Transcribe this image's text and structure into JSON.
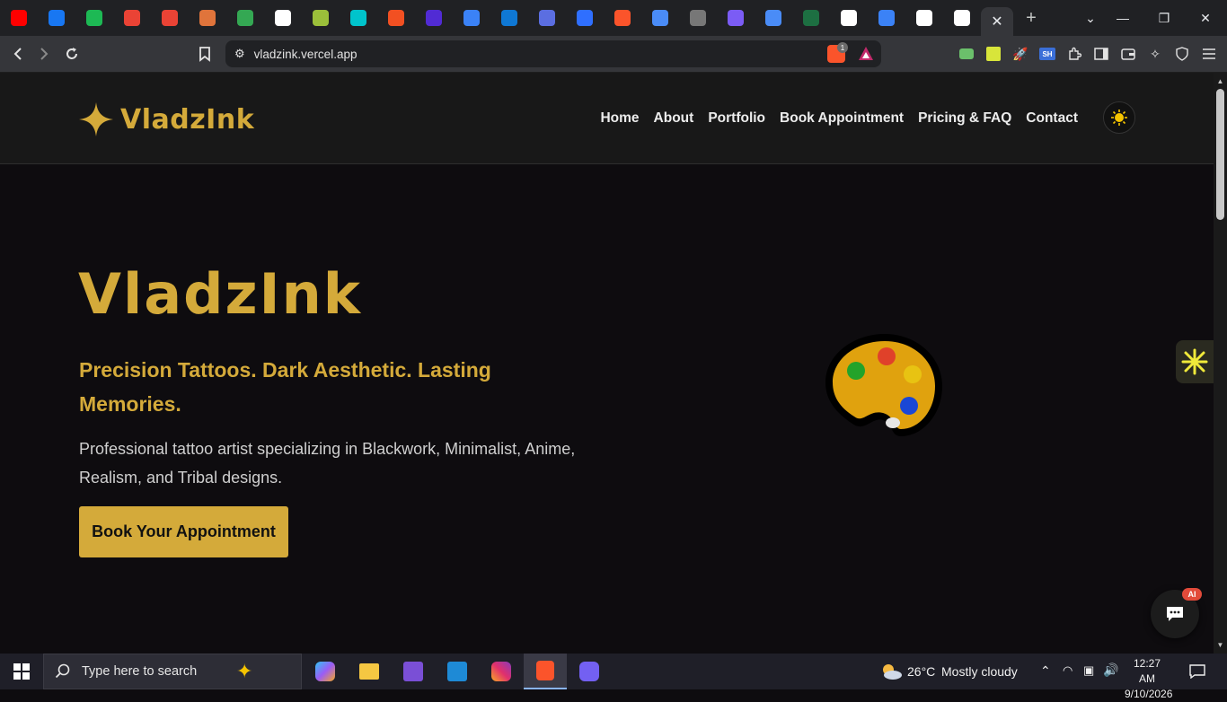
{
  "browser": {
    "tabs": [
      {
        "icon": "youtube-icon",
        "color": "#ff0000"
      },
      {
        "icon": "facebook-icon",
        "color": "#1877f2"
      },
      {
        "icon": "chat-icon",
        "color": "#1db954"
      },
      {
        "icon": "gmail-icon",
        "color": "#ea4335"
      },
      {
        "icon": "gmail-icon",
        "color": "#ea4335"
      },
      {
        "icon": "app-icon",
        "color": "#e0743b"
      },
      {
        "icon": "drive-icon",
        "color": "#34a853"
      },
      {
        "icon": "threads-icon",
        "color": "#ffffff"
      },
      {
        "icon": "app-icon",
        "color": "#9bbf3a"
      },
      {
        "icon": "canva-icon",
        "color": "#00c4cc"
      },
      {
        "icon": "microsoft-icon",
        "color": "#f25022"
      },
      {
        "icon": "dotnet-icon",
        "color": "#512bd4"
      },
      {
        "icon": "app-icon",
        "color": "#3b82f6"
      },
      {
        "icon": "onedrive-icon",
        "color": "#0f78d4"
      },
      {
        "icon": "app-icon",
        "color": "#5b6ee1"
      },
      {
        "icon": "app-icon",
        "color": "#2f6fff"
      },
      {
        "icon": "brave-icon",
        "color": "#fb542b"
      },
      {
        "icon": "gemini-icon",
        "color": "#4a8cf7"
      },
      {
        "icon": "app-icon",
        "color": "#777777"
      },
      {
        "icon": "infinity-icon",
        "color": "#7b5cf5"
      },
      {
        "icon": "gemini-icon",
        "color": "#4a8cf7"
      },
      {
        "icon": "excel-icon",
        "color": "#1d6f42"
      },
      {
        "icon": "openai-icon",
        "color": "#ffffff"
      },
      {
        "icon": "app-icon",
        "color": "#3b82f6"
      },
      {
        "icon": "github-icon",
        "color": "#ffffff"
      },
      {
        "icon": "github-icon",
        "color": "#ffffff"
      }
    ],
    "active_tab_close": "✕",
    "new_tab": "+",
    "url": "vladzink.vercel.app",
    "brave_shield_count": "1"
  },
  "site": {
    "logo_text": "VladzInk",
    "nav": [
      "Home",
      "About",
      "Portfolio",
      "Book Appointment",
      "Pricing & FAQ",
      "Contact"
    ],
    "hero_title": "VladzInk",
    "hero_subtitle": "Precision Tattoos. Dark Aesthetic. Lasting Memories.",
    "hero_description": "Professional tattoo artist specializing in Blackwork, Minimalist, Anime, Realism, and Tribal designs.",
    "cta_label": "Book Your Appointment",
    "chat_badge": "AI",
    "accent_color": "#d4aa3a"
  },
  "taskbar": {
    "search_placeholder": "Type here to search",
    "weather_temp": "26°C",
    "weather_text": "Mostly cloudy",
    "time": "12:27 AM",
    "date": "9/10/2026"
  }
}
